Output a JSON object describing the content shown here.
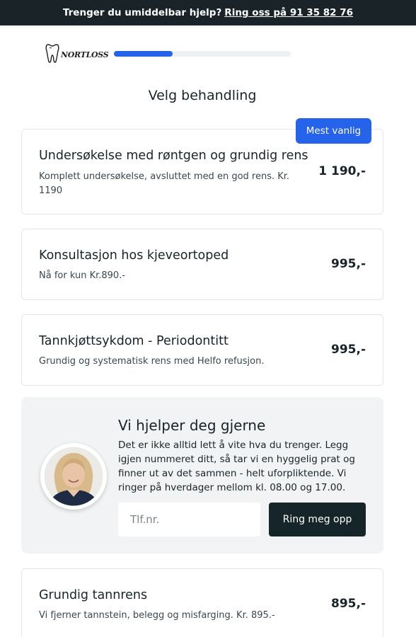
{
  "topbar": {
    "prefix": "Trenger du umiddelbar hjelp?",
    "link": "Ring oss på 91 35 82 76"
  },
  "header": {
    "logo_text": "NORTLOSS",
    "progress_fraction": 0.33
  },
  "page": {
    "title": "Velg behandling"
  },
  "treatments": [
    {
      "title": "Undersøkelse med røntgen og grundig rens",
      "description": "Komplett undersøkelse, avsluttet med en god rens. Kr. 1190",
      "price": "1 190,-",
      "badge": "Mest vanlig"
    },
    {
      "title": "Konsultasjon hos kjeveortoped",
      "description": "Nå for kun Kr.890.-",
      "price": "995,-"
    },
    {
      "title": "Tannkjøttsykdom - Periodontitt",
      "description": "Grundig og systematisk rens med Helfo refusjon.",
      "price": "995,-"
    },
    {
      "title": "Grundig tannrens",
      "description": "Vi fjerner tannstein, belegg og misfarging. Kr. 895.-",
      "price": "895,-"
    }
  ],
  "help": {
    "title": "Vi hjelper deg gjerne",
    "text": "Det er ikke alltid lett å vite hva du trenger. Legg igjen nummeret ditt, så tar vi en hyggelig prat og finner ut av det sammen - helt uforpliktende. Vi ringer på hverdager mellom kl. 08.00 og 17.00.",
    "phone_placeholder": "Tlf.nr.",
    "phone_value": "",
    "button_label": "Ring meg opp"
  },
  "colors": {
    "accent": "#2563eb",
    "dark": "#1a2328",
    "help_bg": "#f2f3f4"
  },
  "icons": {
    "logo": "tooth-icon",
    "avatar": "person-avatar"
  }
}
